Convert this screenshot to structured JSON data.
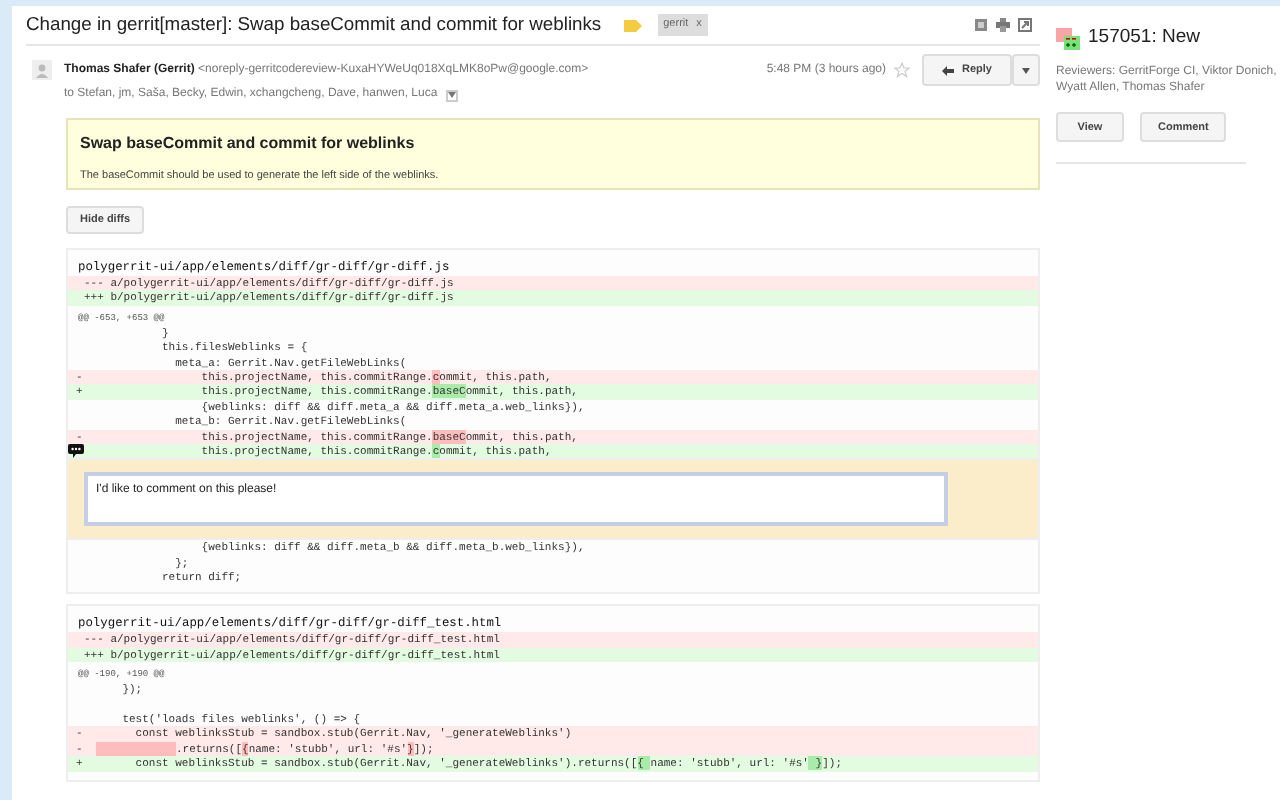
{
  "email": {
    "subject": "Change in gerrit[master]: Swap baseCommit and commit for weblinks",
    "label": {
      "text": "gerrit",
      "close": "x"
    },
    "sender": {
      "name": "Thomas Shafer (Gerrit)",
      "address": "<noreply-gerritcodereview-KuxaHYWeUq018XqLMK8oPw@google.com>",
      "recipients": "to Stefan, jm, Saša, Becky, Edwin, xchangcheng, Dave, hanwen, Luca"
    },
    "time": "5:48 PM (3 hours ago)",
    "starred": false,
    "reply_button": "Reply",
    "summary": {
      "title": "Swap baseCommit and commit for weblinks",
      "body": "The baseCommit should be used to generate the left side of the weblinks."
    },
    "hide_diffs_button": "Hide diffs",
    "files": [
      {
        "filename": "polygerrit-ui/app/elements/diff/gr-diff/gr-diff.js",
        "old_path": "--- a/polygerrit-ui/app/elements/diff/gr-diff/gr-diff.js",
        "new_path": "+++ b/polygerrit-ui/app/elements/diff/gr-diff/gr-diff.js",
        "hunk": "@@ -653, +653 @@",
        "lines": [
          {
            "kind": "context",
            "code": "          }"
          },
          {
            "kind": "context",
            "code": "          this.filesWeblinks = {"
          },
          {
            "kind": "context",
            "code": "            meta_a: Gerrit.Nav.getFileWebLinks("
          },
          {
            "kind": "removed",
            "sign": "-",
            "parts": [
              {
                "text": "                this.projectName, this.commitRange.",
                "changed": false
              },
              {
                "text": "c",
                "changed": true
              },
              {
                "text": "ommit, this.path,",
                "changed": false
              }
            ]
          },
          {
            "kind": "added",
            "sign": "+",
            "parts": [
              {
                "text": "                this.projectName, this.commitRange.",
                "changed": false
              },
              {
                "text": "baseC",
                "changed": true
              },
              {
                "text": "ommit, this.path,",
                "changed": false
              }
            ]
          },
          {
            "kind": "context",
            "code": "                {weblinks: diff && diff.meta_a && diff.meta_a.web_links}),"
          },
          {
            "kind": "context",
            "code": "            meta_b: Gerrit.Nav.getFileWebLinks("
          },
          {
            "kind": "removed",
            "sign": "-",
            "parts": [
              {
                "text": "                this.projectName, this.commitRange.",
                "changed": false
              },
              {
                "text": "baseC",
                "changed": true
              },
              {
                "text": "ommit, this.path,",
                "changed": false
              }
            ]
          },
          {
            "kind": "added",
            "has_comment": true,
            "parts": [
              {
                "text": "                this.projectName, this.commitRange.",
                "changed": false
              },
              {
                "text": "c",
                "changed": true
              },
              {
                "text": "ommit, this.path,",
                "changed": false
              }
            ]
          },
          {
            "kind": "comment",
            "text": "I'd like to comment on this please!"
          },
          {
            "kind": "context",
            "code": "                {weblinks: diff && diff.meta_b && diff.meta_b.web_links}),"
          },
          {
            "kind": "context",
            "code": "            };"
          },
          {
            "kind": "context",
            "code": "          return diff;"
          }
        ]
      },
      {
        "filename": "polygerrit-ui/app/elements/diff/gr-diff/gr-diff_test.html",
        "old_path": "--- a/polygerrit-ui/app/elements/diff/gr-diff/gr-diff_test.html",
        "new_path": "+++ b/polygerrit-ui/app/elements/diff/gr-diff/gr-diff_test.html",
        "hunk": "@@ -190, +190 @@",
        "lines": [
          {
            "kind": "context",
            "code": "    });"
          },
          {
            "kind": "blank"
          },
          {
            "kind": "context",
            "code": "    test('loads files weblinks', () => {"
          },
          {
            "kind": "removed",
            "sign": "-",
            "parts": [
              {
                "text": "      const weblinksStub = sandbox.stub(Gerrit.Nav, '_generateWeblinks')",
                "changed": false
              }
            ]
          },
          {
            "kind": "removed",
            "sign": "-",
            "indent_changed": true,
            "parts": [
              {
                "text": ".returns([",
                "changed": false
              },
              {
                "text": "{",
                "changed": true
              },
              {
                "text": "name: 'stubb', url: '#s'",
                "changed": false
              },
              {
                "text": "}",
                "changed": true
              },
              {
                "text": "]);",
                "changed": false
              }
            ]
          },
          {
            "kind": "added",
            "sign": "+",
            "parts": [
              {
                "text": "      const weblinksStub = sandbox.stub(Gerrit.Nav, '_generateWeblinks').returns([",
                "changed": false
              },
              {
                "text": "{ ",
                "changed": true
              },
              {
                "text": "name: 'stubb', url: '#s'",
                "changed": false
              },
              {
                "text": " }",
                "changed": true
              },
              {
                "text": "]);",
                "changed": false
              }
            ]
          }
        ]
      }
    ]
  },
  "sidebar": {
    "change": "157051: New",
    "reviewers": "Reviewers: GerritForge CI, Viktor Donich, Wyatt Allen, Thomas Shafer",
    "buttons": [
      "View",
      "Comment"
    ]
  }
}
